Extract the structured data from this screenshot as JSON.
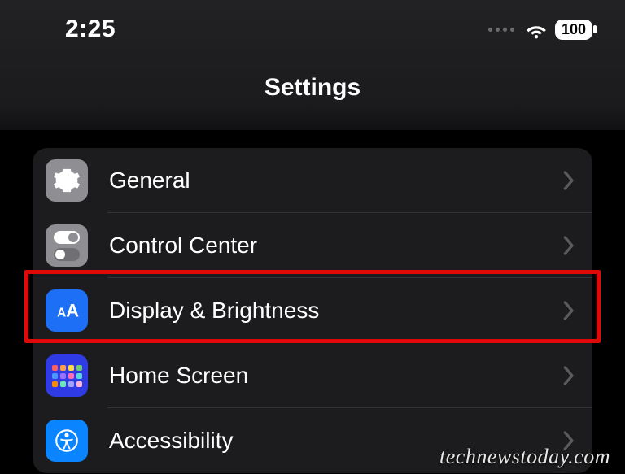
{
  "status": {
    "time": "2:25",
    "battery": "100"
  },
  "header": {
    "title": "Settings"
  },
  "menu": {
    "items": [
      {
        "id": "general",
        "label": "General"
      },
      {
        "id": "control",
        "label": "Control Center"
      },
      {
        "id": "display",
        "label": "Display & Brightness"
      },
      {
        "id": "home",
        "label": "Home Screen"
      },
      {
        "id": "accessibility",
        "label": "Accessibility"
      }
    ]
  },
  "highlighted_item_index": 2,
  "watermark": "technewstoday.com"
}
